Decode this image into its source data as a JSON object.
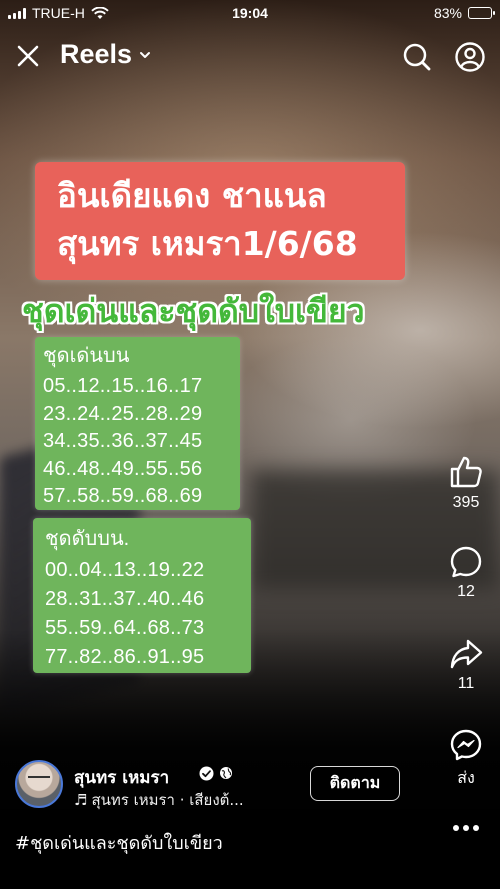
{
  "status_bar": {
    "carrier": "TRUE-H",
    "time": "19:04",
    "battery": "83%",
    "battery_level": 0.83
  },
  "header": {
    "title": "Reels",
    "icons": [
      "close-icon",
      "chevron-down-icon",
      "search-icon",
      "profile-icon"
    ]
  },
  "video": {
    "banner_line1": "อินเดียแดง  ชาแนล",
    "banner_line2": "สุนทร เหมรา1/6/68",
    "green_title": "ชุดเด่นและชุดดับใบเขียว",
    "box1": {
      "heading": "ชุดเด่นบน",
      "rows": [
        "05..12..15..16..17",
        "23..24..25..28..29",
        "34..35..36..37..45",
        "46..48..49..55..56",
        "57..58..59..68..69"
      ]
    },
    "box2": {
      "heading": "ชุดดับบน.",
      "rows": [
        "00..04..13..19..22",
        "28..31..37..40..46",
        "55..59..64..68..73",
        "77..82..86..91..95"
      ]
    },
    "colors": {
      "banner_red": "#e8625a",
      "title_green": "#44b83a",
      "box_green": "#6fb55c"
    }
  },
  "actions": {
    "likes": "395",
    "comments": "12",
    "shares": "11",
    "send_label": "ส่ง"
  },
  "author": {
    "name": "สุนทร เหมรา",
    "music": "สุนทร เหมรา · เสียงต้...",
    "follow_label": "ติดตาม"
  },
  "caption": "#ชุดเด่นและชุดดับใบเขียว"
}
